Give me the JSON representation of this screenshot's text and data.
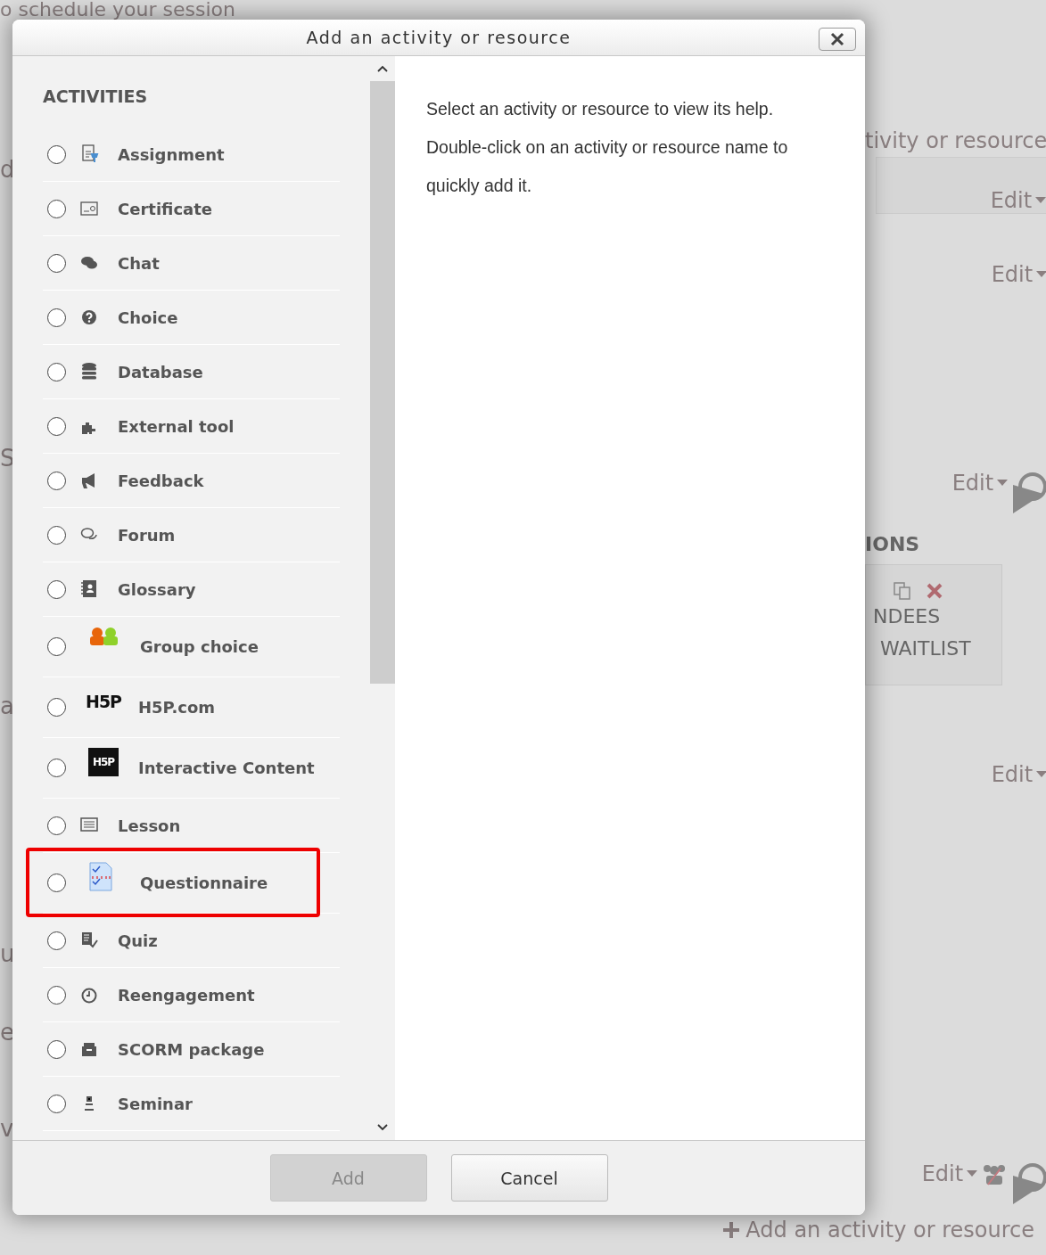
{
  "background": {
    "top_line": "o schedule your session",
    "left_fragments": [
      "d",
      "S",
      "a",
      "u",
      "e",
      "v"
    ],
    "right": {
      "top_link": "tivity or resource",
      "edit_links": [
        "Edit",
        "Edit",
        "Edit",
        "Edit",
        "Edit"
      ],
      "section_heading": "IONS",
      "attendee_lines": [
        "NDEES",
        "WAITLIST"
      ]
    },
    "add_link": "Add an activity or resource"
  },
  "dialog": {
    "title": "Add an activity or resource",
    "section_heading": "ACTIVITIES",
    "items": [
      {
        "label": "Assignment",
        "kind": "glyph",
        "selected": false,
        "highlighted": false
      },
      {
        "label": "Certificate",
        "kind": "glyph",
        "selected": false,
        "highlighted": false
      },
      {
        "label": "Chat",
        "kind": "glyph",
        "selected": false,
        "highlighted": false
      },
      {
        "label": "Choice",
        "kind": "glyph",
        "selected": false,
        "highlighted": false
      },
      {
        "label": "Database",
        "kind": "glyph",
        "selected": false,
        "highlighted": false
      },
      {
        "label": "External tool",
        "kind": "glyph",
        "selected": false,
        "highlighted": false
      },
      {
        "label": "Feedback",
        "kind": "glyph",
        "selected": false,
        "highlighted": false
      },
      {
        "label": "Forum",
        "kind": "glyph",
        "selected": false,
        "highlighted": false
      },
      {
        "label": "Glossary",
        "kind": "glyph",
        "selected": false,
        "highlighted": false
      },
      {
        "label": "Group choice",
        "kind": "image",
        "selected": false,
        "highlighted": false
      },
      {
        "label": "H5P.com",
        "kind": "image",
        "logo_text": "H5P",
        "selected": false,
        "highlighted": false
      },
      {
        "label": "Interactive Content",
        "kind": "image",
        "logo_text": "H5P",
        "selected": false,
        "highlighted": false
      },
      {
        "label": "Lesson",
        "kind": "glyph",
        "selected": false,
        "highlighted": false
      },
      {
        "label": "Questionnaire",
        "kind": "image",
        "selected": false,
        "highlighted": true
      },
      {
        "label": "Quiz",
        "kind": "glyph",
        "selected": false,
        "highlighted": false
      },
      {
        "label": "Reengagement",
        "kind": "glyph",
        "selected": false,
        "highlighted": false
      },
      {
        "label": "SCORM package",
        "kind": "glyph",
        "selected": false,
        "highlighted": false
      },
      {
        "label": "Seminar",
        "kind": "glyph",
        "selected": false,
        "highlighted": false
      }
    ],
    "help_lines": [
      "Select an activity or resource to view its help.",
      "Double-click on an activity or resource name to quickly add it."
    ],
    "buttons": [
      {
        "label": "Add",
        "disabled": true
      },
      {
        "label": "Cancel",
        "disabled": false
      }
    ]
  }
}
